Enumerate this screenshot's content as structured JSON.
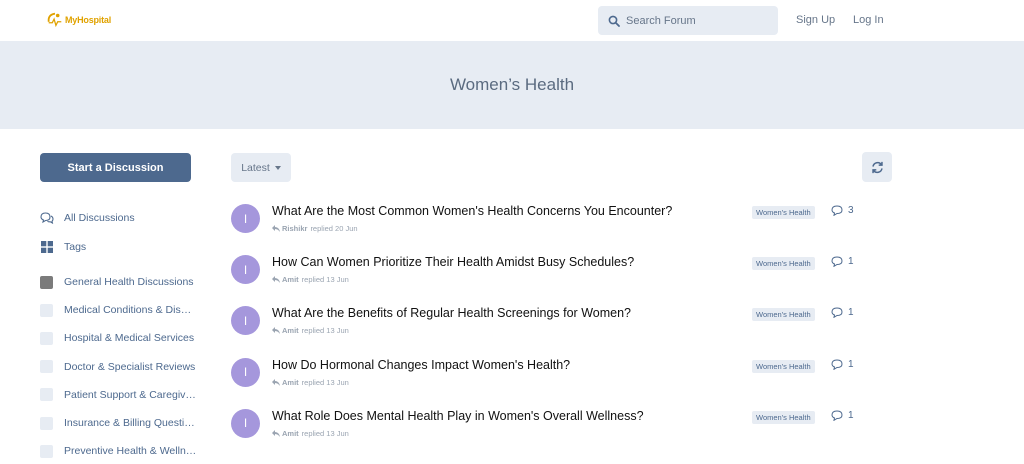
{
  "header": {
    "logo_text": "MyHospital",
    "search_placeholder": "Search Forum",
    "signup_label": "Sign Up",
    "login_label": "Log In"
  },
  "hero": {
    "title": "Women’s Health"
  },
  "sidebar": {
    "start_label": "Start a Discussion",
    "nav": [
      {
        "label": "All Discussions",
        "icon": "comments-icon"
      },
      {
        "label": "Tags",
        "icon": "tags-grid-icon"
      }
    ],
    "tags": [
      {
        "label": "General Health Discussions",
        "active": true
      },
      {
        "label": "Medical Conditions & Dis…",
        "active": false
      },
      {
        "label": "Hospital & Medical Services",
        "active": false
      },
      {
        "label": "Doctor & Specialist Reviews",
        "active": false
      },
      {
        "label": "Patient Support & Caregiv…",
        "active": false
      },
      {
        "label": "Insurance & Billing Questi…",
        "active": false
      },
      {
        "label": "Preventive Health & Welln…",
        "active": false
      }
    ]
  },
  "toolbar": {
    "sort_label": "Latest"
  },
  "discussions": [
    {
      "avatar": "I",
      "title": "What Are the Most Common Women's Health Concerns You Encounter?",
      "user": "Rishikr",
      "action": "replied 20 Jun",
      "tag": "Women's Health",
      "replies": "3"
    },
    {
      "avatar": "I",
      "title": "How Can Women Prioritize Their Health Amidst Busy Schedules?",
      "user": "Amit",
      "action": "replied 13 Jun",
      "tag": "Women's Health",
      "replies": "1"
    },
    {
      "avatar": "I",
      "title": "What Are the Benefits of Regular Health Screenings for Women?",
      "user": "Amit",
      "action": "replied 13 Jun",
      "tag": "Women's Health",
      "replies": "1"
    },
    {
      "avatar": "I",
      "title": "How Do Hormonal Changes Impact Women's Health?",
      "user": "Amit",
      "action": "replied 13 Jun",
      "tag": "Women's Health",
      "replies": "1"
    },
    {
      "avatar": "I",
      "title": "What Role Does Mental Health Play in Women's Overall Wellness?",
      "user": "Amit",
      "action": "replied 13 Jun",
      "tag": "Women's Health",
      "replies": "1"
    }
  ],
  "colors": {
    "accent": "#4d698e",
    "logo": "#e0a200",
    "hero_bg": "#e7ecf3",
    "avatar_bg": "#a597dc"
  }
}
